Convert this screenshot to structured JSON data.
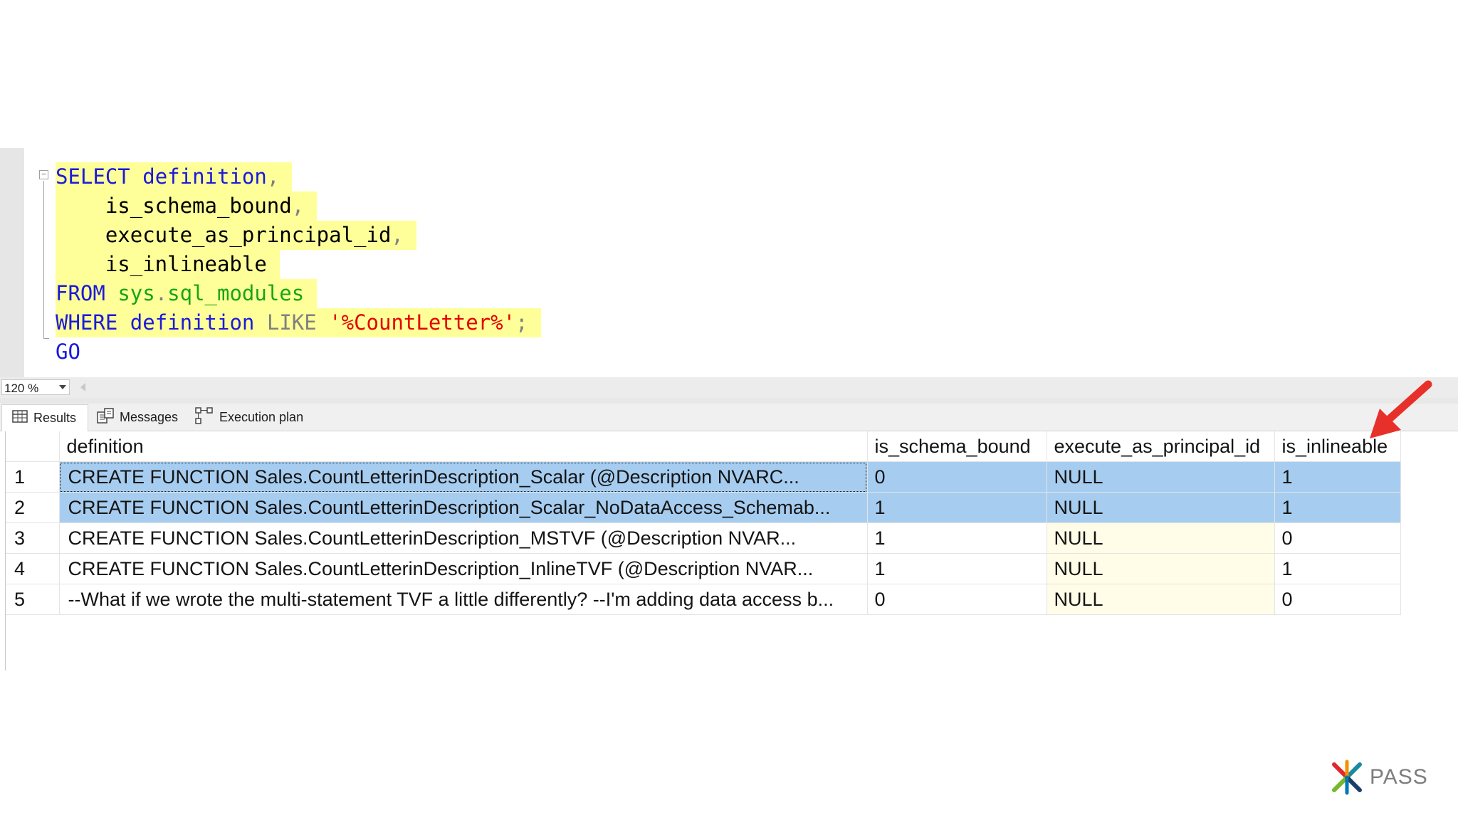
{
  "editor": {
    "lines": [
      [
        {
          "t": "SELECT",
          "c": "kw"
        },
        {
          "t": " ",
          "c": ""
        },
        {
          "t": "definition",
          "c": "kw"
        },
        {
          "t": ",",
          "c": "gray"
        }
      ],
      [
        {
          "t": "    is_schema_bound",
          "c": ""
        },
        {
          "t": ",",
          "c": "gray"
        }
      ],
      [
        {
          "t": "    execute_as_principal_id",
          "c": ""
        },
        {
          "t": ",",
          "c": "gray"
        }
      ],
      [
        {
          "t": "    is_inlineable",
          "c": ""
        }
      ],
      [
        {
          "t": "FROM",
          "c": "kw"
        },
        {
          "t": " ",
          "c": ""
        },
        {
          "t": "sys",
          "c": "obj"
        },
        {
          "t": ".",
          "c": "gray"
        },
        {
          "t": "sql_modules",
          "c": "obj"
        }
      ],
      [
        {
          "t": "WHERE",
          "c": "kw"
        },
        {
          "t": " ",
          "c": ""
        },
        {
          "t": "definition",
          "c": "kw"
        },
        {
          "t": " ",
          "c": ""
        },
        {
          "t": "LIKE",
          "c": "gray"
        },
        {
          "t": " ",
          "c": ""
        },
        {
          "t": "'%CountLetter%'",
          "c": "str"
        },
        {
          "t": ";",
          "c": "gray"
        }
      ],
      [
        {
          "t": "GO",
          "c": "kw"
        }
      ]
    ]
  },
  "zoom": {
    "value": "120 %"
  },
  "tabs": {
    "results": "Results",
    "messages": "Messages",
    "execution_plan": "Execution plan"
  },
  "grid": {
    "columns": [
      "definition",
      "is_schema_bound",
      "execute_as_principal_id",
      "is_inlineable"
    ],
    "rows": [
      [
        "1",
        "   CREATE   FUNCTION Sales.CountLetterinDescription_Scalar        (@Description NVARC...",
        "0",
        "NULL",
        "1"
      ],
      [
        "2",
        "   CREATE   FUNCTION Sales.CountLetterinDescription_Scalar_NoDataAccess_Schemab...",
        "1",
        "NULL",
        "1"
      ],
      [
        "3",
        "   CREATE   FUNCTION Sales.CountLetterinDescription_MSTVF        (@Description NVAR...",
        "1",
        "NULL",
        "0"
      ],
      [
        "4",
        "CREATE   FUNCTION Sales.CountLetterinDescription_InlineTVF       (@Description NVAR...",
        "1",
        "NULL",
        "1"
      ],
      [
        "5",
        "   --What if we wrote the multi-statement TVF a little differently?  --I'm adding data access b...",
        "0",
        "NULL",
        "0"
      ]
    ],
    "selected_rows": [
      1,
      2
    ]
  },
  "logo": {
    "text": "PASS"
  },
  "colors": {
    "keyword": "#1a1adc",
    "object": "#17a517",
    "string": "#e60000",
    "highlight": "#ffff99",
    "selection": "#a6cdf0",
    "arrow": "#e8302a"
  }
}
